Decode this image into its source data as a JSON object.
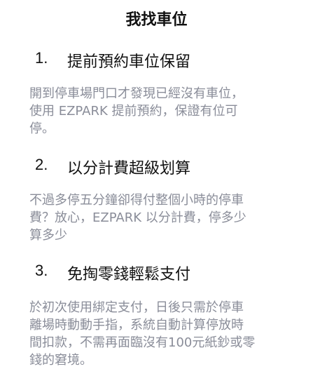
{
  "title": "我找車位",
  "sections": [
    {
      "number": "1.",
      "heading": "提前預約車位保留",
      "lines": [
        "開到停車場門口才發現已經沒有車位，",
        "使用 EZPARK 提前預約，保證有位可",
        "停。"
      ]
    },
    {
      "number": "2.",
      "heading": "以分計費超級划算",
      "lines": [
        "不過多停五分鐘卻得付整個小時的停車",
        "費？放心，EZPARK 以分計費，停多少",
        "算多少"
      ]
    },
    {
      "number": "3.",
      "heading": "免掏零錢輕鬆支付",
      "lines": [
        "於初次使用綁定支付，日後只需於停車",
        "離場時動動手指，系統自動計算停放時",
        "間扣款，不需再面臨沒有100元紙鈔或零",
        "錢的窘境。"
      ]
    }
  ]
}
